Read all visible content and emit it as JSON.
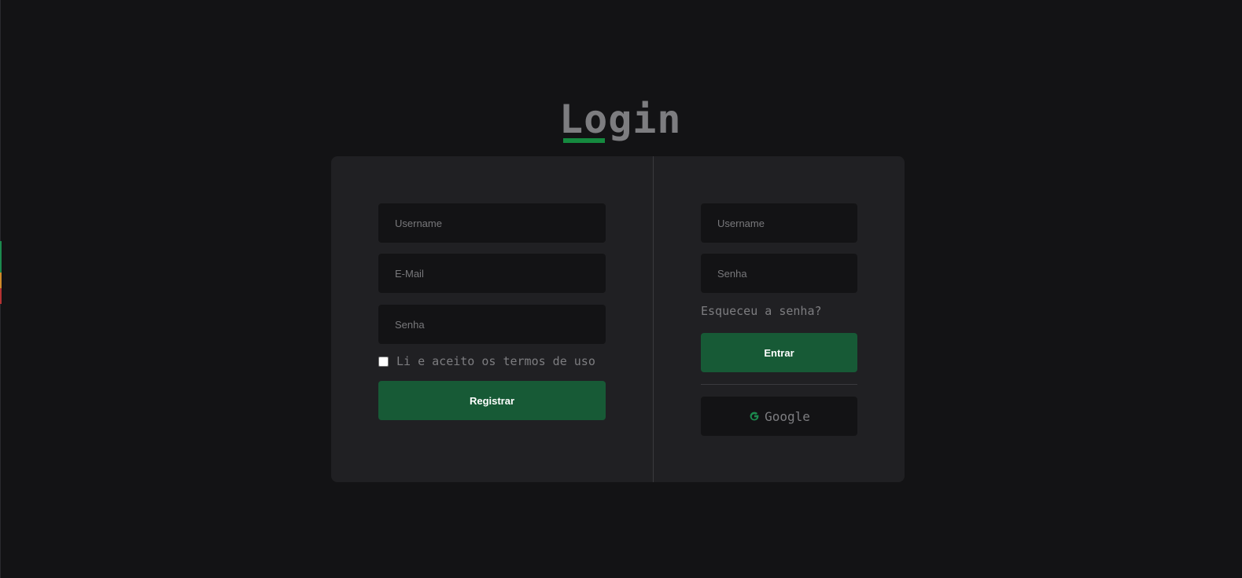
{
  "page": {
    "title": "Login"
  },
  "register_form": {
    "username_placeholder": "Username",
    "email_placeholder": "E-Mail",
    "password_placeholder": "Senha",
    "terms_label": "Li e aceito os termos de uso",
    "terms_checked": false,
    "submit_label": "Registrar"
  },
  "login_form": {
    "username_placeholder": "Username",
    "password_placeholder": "Senha",
    "forgot_password_label": "Esqueceu a senha?",
    "submit_label": "Entrar",
    "google_label": "Google",
    "google_icon": "google-g-icon"
  },
  "colors": {
    "background": "#131315",
    "card": "#202023",
    "accent_green": "#175a36",
    "underline_green": "#158a3f",
    "muted_text": "#7d7d80"
  }
}
